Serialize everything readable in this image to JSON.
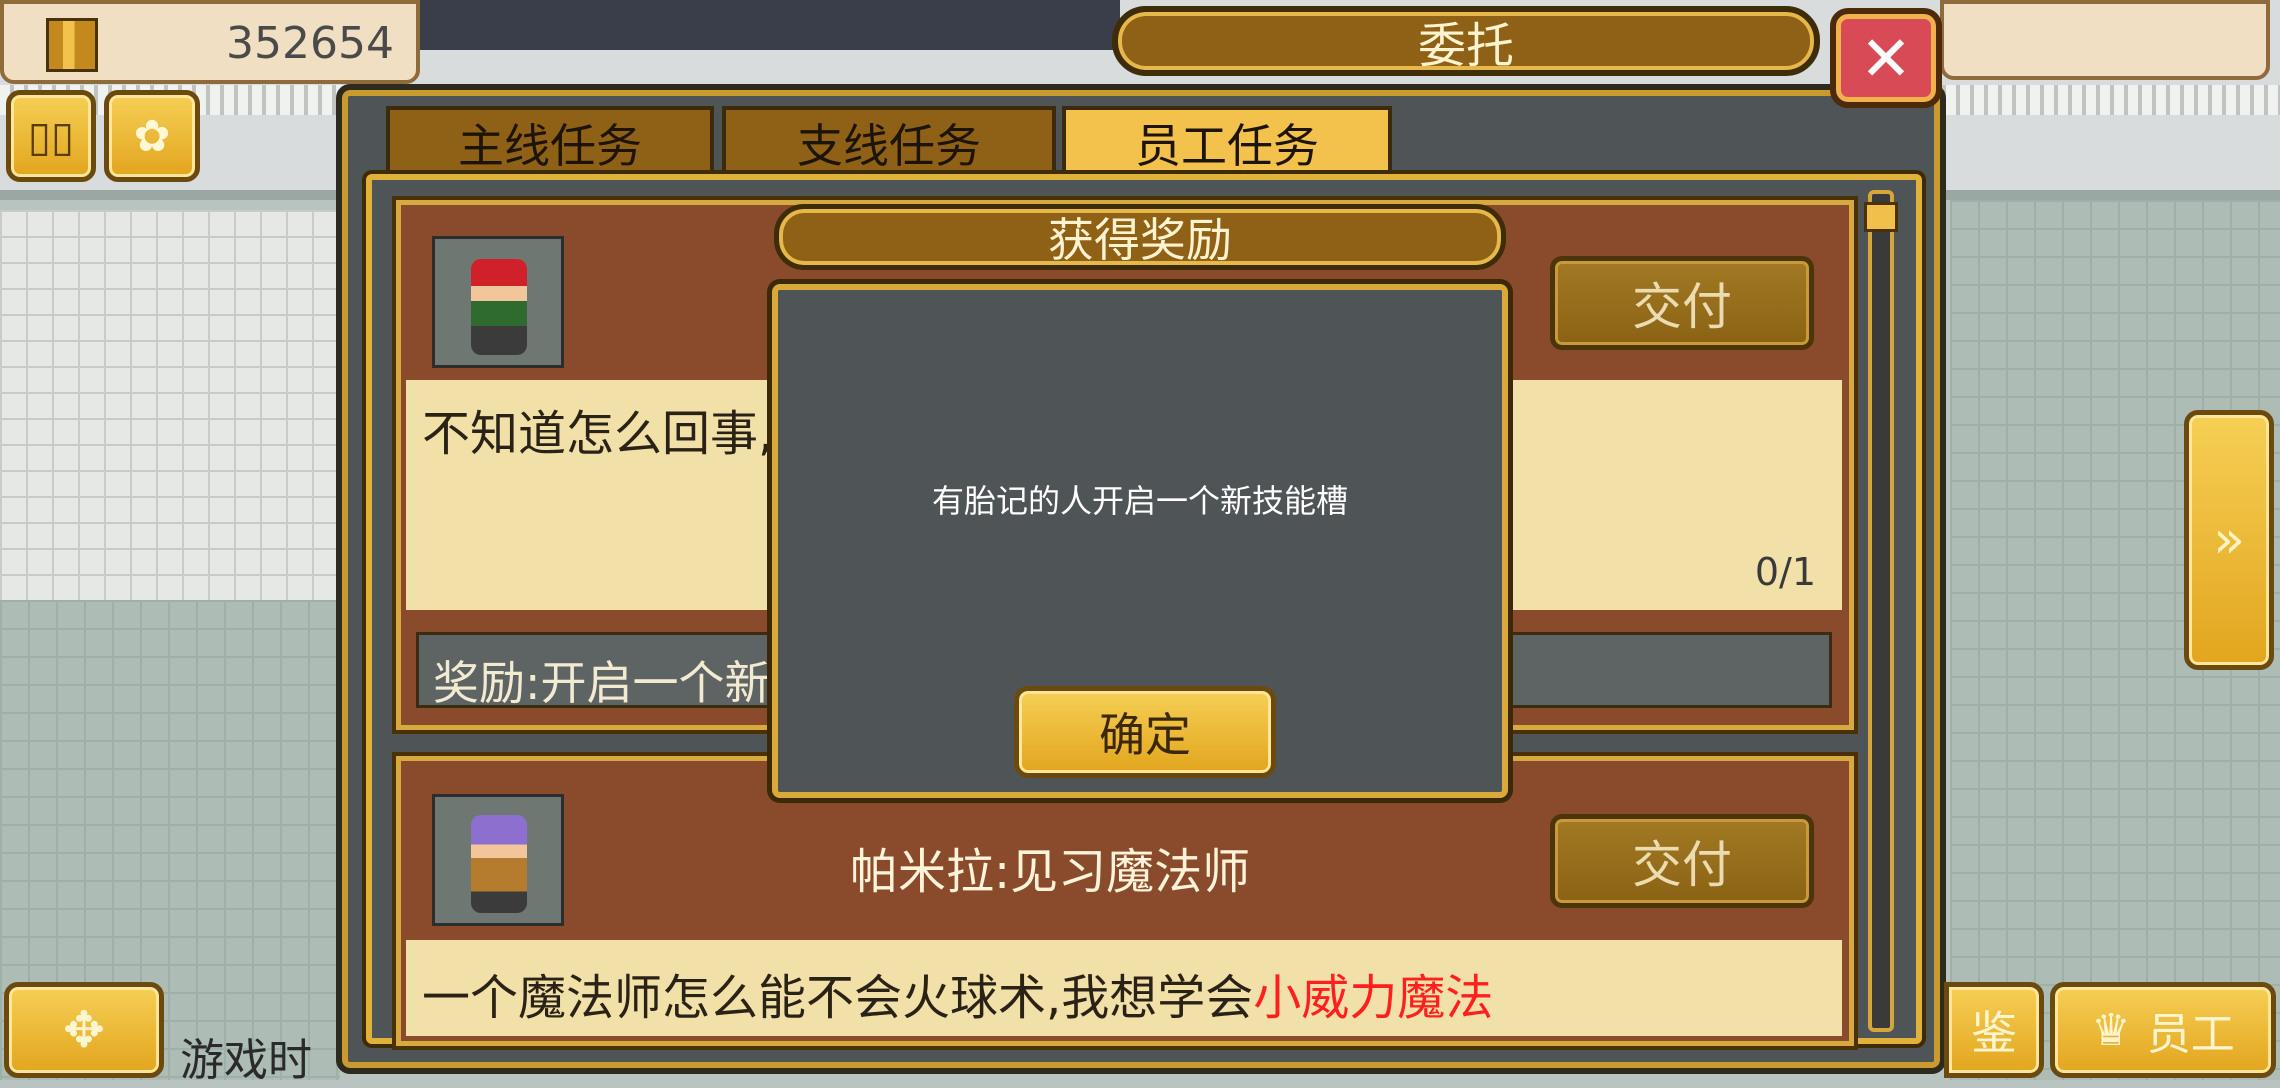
{
  "hud": {
    "money": "352654"
  },
  "window": {
    "title": "委托",
    "close_symbol": "✕"
  },
  "tabs": [
    {
      "label": "主线任务",
      "active": false
    },
    {
      "label": "支线任务",
      "active": false
    },
    {
      "label": "员工任务",
      "active": true
    }
  ],
  "quests": [
    {
      "title": "",
      "description": "不知道怎么回事,",
      "progress": "0/1",
      "reward": "奖励:开启一个新",
      "deliver_label": "交付"
    },
    {
      "title": "帕米拉:见习魔法师",
      "description": "一个魔法师怎么能不会火球术,我想学会",
      "highlight": "小威力魔法",
      "deliver_label": "交付"
    }
  ],
  "popup": {
    "title": "获得奖励",
    "message": "有胎记的人开启一个新技能槽",
    "confirm_label": "确定"
  },
  "bottom": {
    "game_time_partial": "游戏时",
    "staff_label": "员工",
    "partial_button": "鉴"
  },
  "colors": {
    "gold": "#f3c24c",
    "dark_gold": "#8f6116",
    "card_brown": "#8a4b2c",
    "panel_gray": "#4f5457",
    "highlight_red": "#ff1f1f"
  }
}
